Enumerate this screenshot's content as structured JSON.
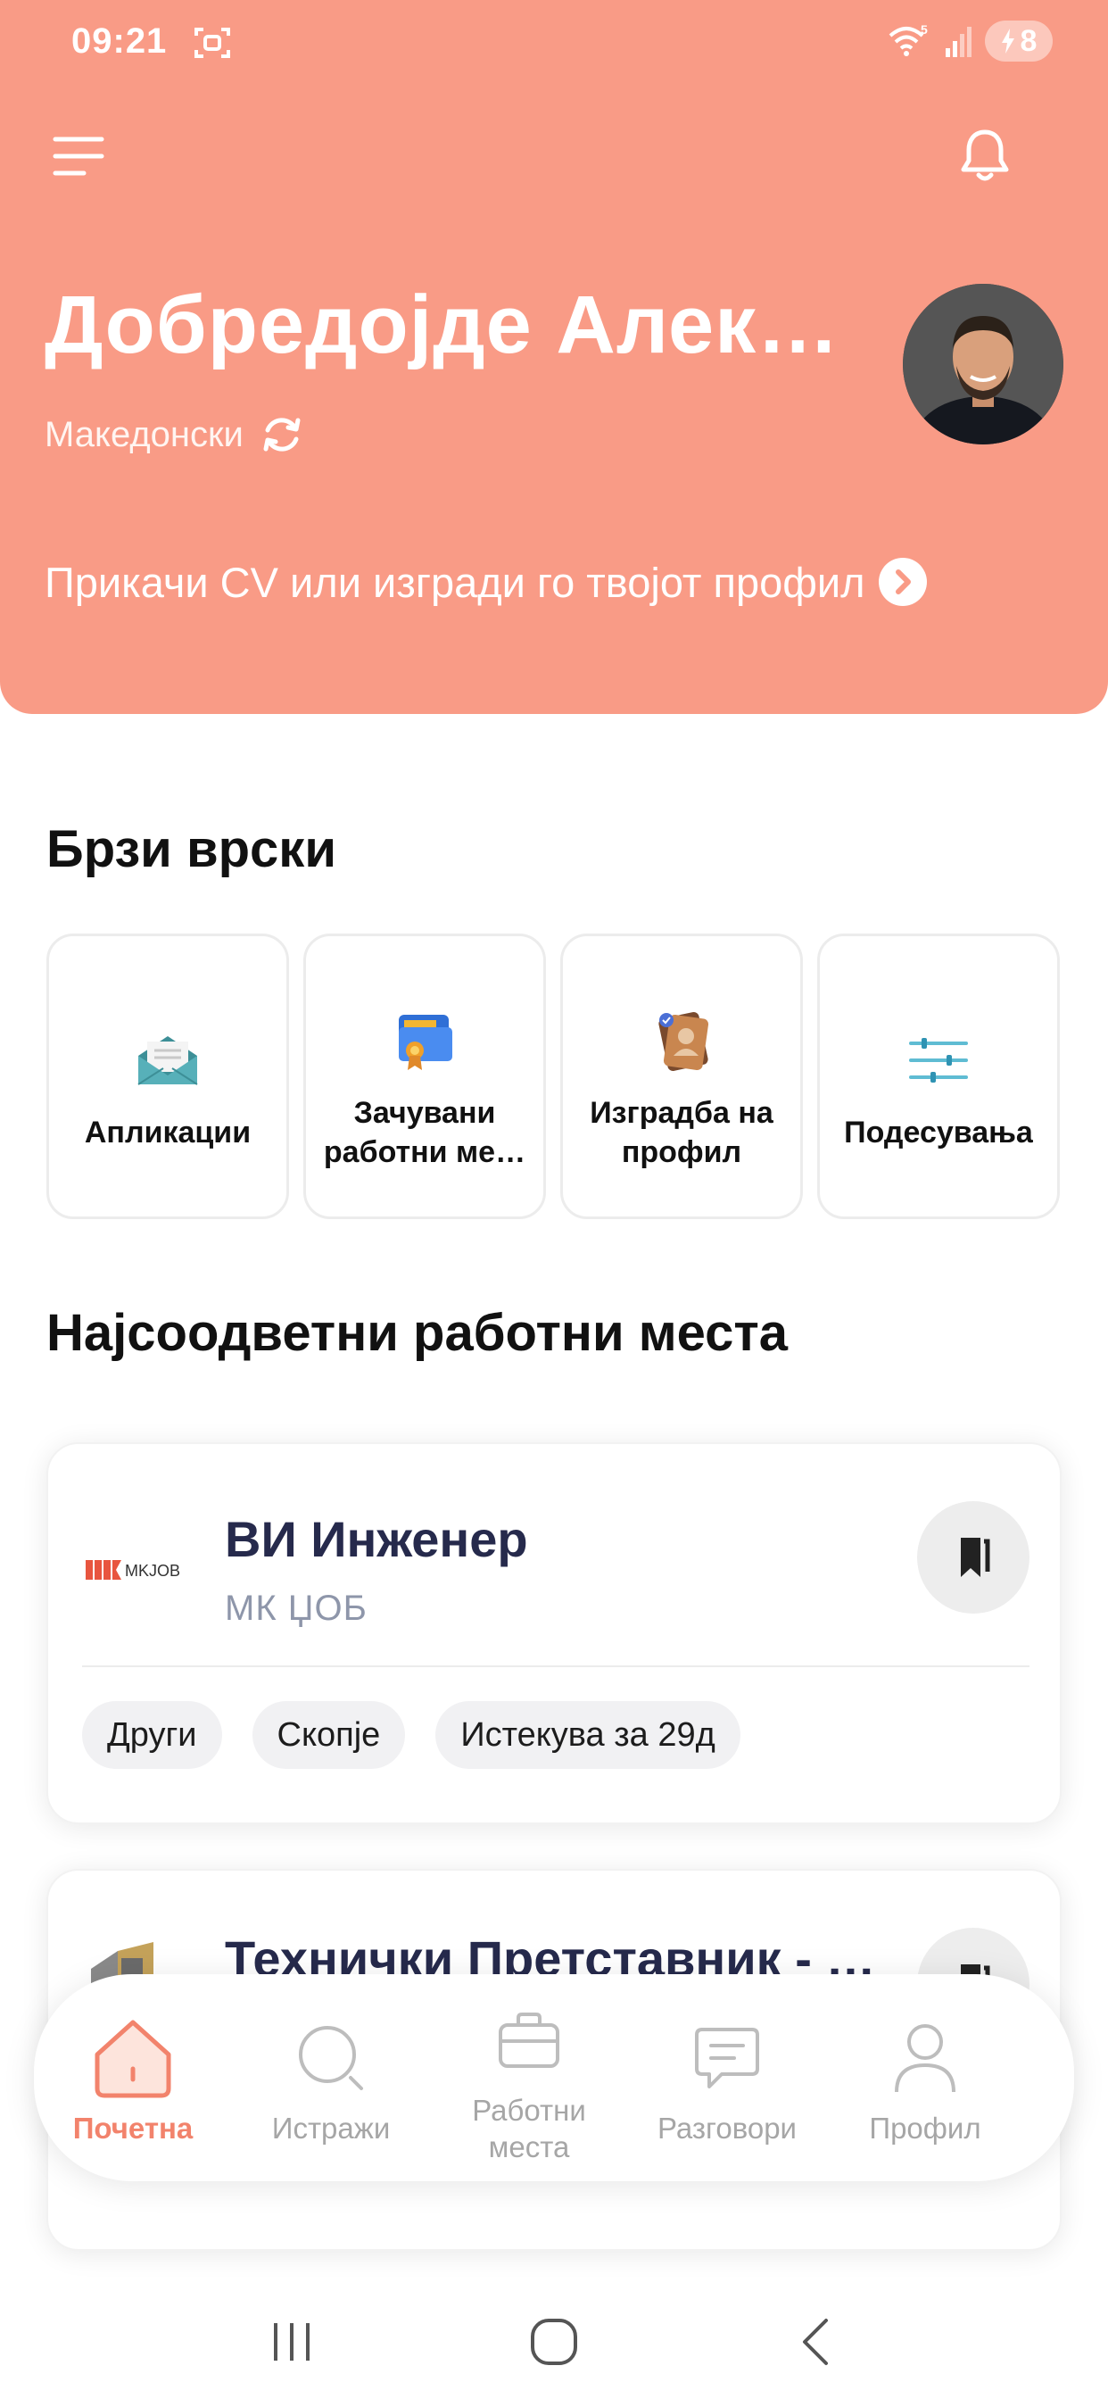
{
  "status_bar": {
    "time": "09:21",
    "battery": "8",
    "signal_label": "5"
  },
  "header": {
    "greeting": "Добредојде Алек…",
    "language": "Македонски",
    "cv_prompt": "Прикачи CV или изгради го твојот профил"
  },
  "quick_links": {
    "title": "Брзи врски",
    "items": [
      {
        "label": "Апликации",
        "icon": "envelope-icon"
      },
      {
        "label": "Зачувани работни ме…",
        "icon": "saved-folder-icon"
      },
      {
        "label": "Изградба на профил",
        "icon": "profile-card-icon"
      },
      {
        "label": "Подесувања",
        "icon": "sliders-icon"
      }
    ]
  },
  "jobs": {
    "title": "Најсоодветни работни места",
    "items": [
      {
        "title": "ВИ Инженер",
        "company": "МК ЏОБ",
        "logo_text": "MKJOB",
        "tags": [
          "Други",
          "Скопје",
          "Истекува за 29д"
        ]
      },
      {
        "title": "Технички Претставник - …",
        "company": "",
        "tags": []
      }
    ]
  },
  "bottom_nav": {
    "items": [
      {
        "label": "Почетна",
        "icon": "home-icon",
        "active": true
      },
      {
        "label": "Истражи",
        "icon": "search-icon",
        "active": false
      },
      {
        "label": "Работни места",
        "icon": "briefcase-icon",
        "active": false
      },
      {
        "label": "Разговори",
        "icon": "chat-icon",
        "active": false
      },
      {
        "label": "Профил",
        "icon": "user-icon",
        "active": false
      }
    ]
  },
  "colors": {
    "header_bg": "#f99b86",
    "accent": "#f2836c",
    "job_title": "#262a4c"
  }
}
